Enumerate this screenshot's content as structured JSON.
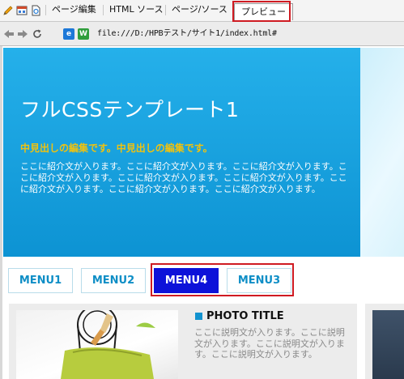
{
  "tabs": {
    "edit": "ページ編集",
    "html_source": "HTML ソース",
    "page_source": "ページ/ソース",
    "preview": "プレビュー"
  },
  "address": {
    "back_icon": "back-arrow-icon",
    "forward_icon": "forward-arrow-icon",
    "reload_icon": "reload-icon",
    "ie_label": "e",
    "other_label": "W",
    "url": "file:///D:/HPBテスト/サイト1/index.html#"
  },
  "hero": {
    "title": "フルCSSテンプレート1",
    "subtitle": "中見出しの編集です。中見出しの編集です。",
    "body": "ここに紹介文が入ります。ここに紹介文が入ります。ここに紹介文が入ります。ここに紹介文が入ります。ここに紹介文が入ります。ここに紹介文が入ります。ここに紹介文が入ります。ここに紹介文が入ります。ここに紹介文が入ります。"
  },
  "menu": {
    "items": [
      "MENU1",
      "MENU2",
      "MENU4",
      "MENU3"
    ],
    "active": "MENU4"
  },
  "content": {
    "photo_title": "PHOTO TITLE",
    "photo_desc": "ここに説明文が入ります。ここに説明文が入ります。ここに説明文が入ります。ここに説明文が入ります。"
  },
  "colors": {
    "accent": "#0d93d3",
    "menu_active": "#0d12d9",
    "highlight": "#cf1b22",
    "subtitle": "#f0c20f"
  }
}
